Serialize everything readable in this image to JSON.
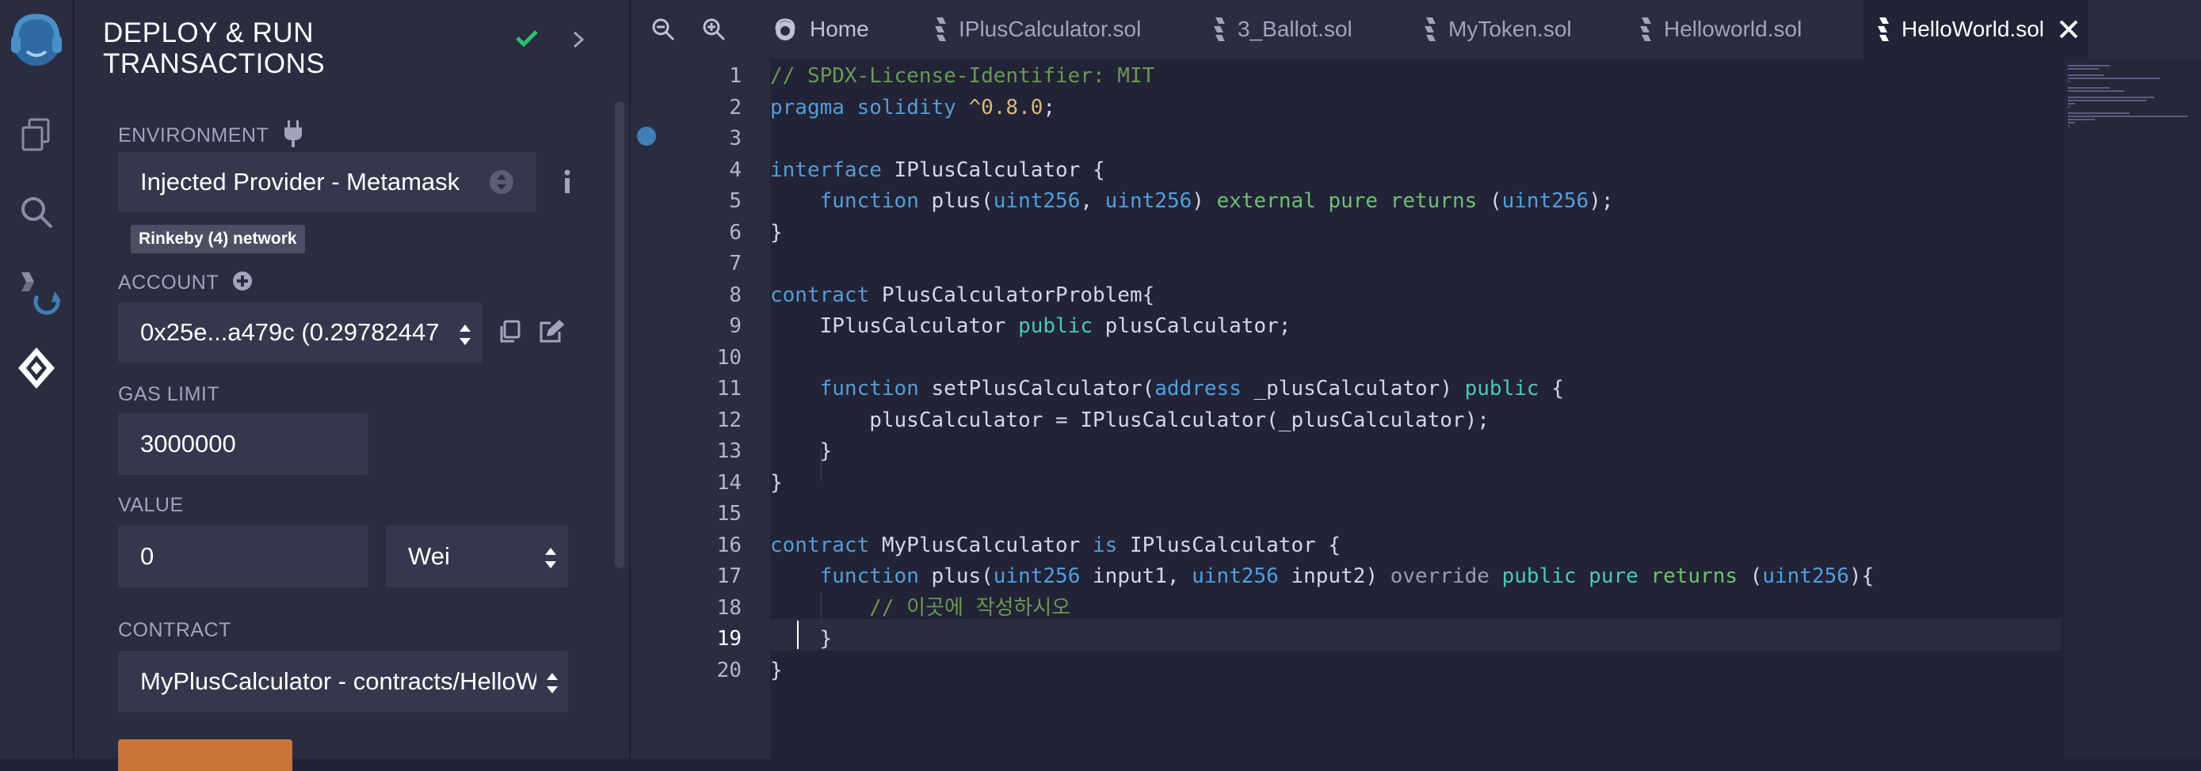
{
  "panel": {
    "title_line1": "DEPLOY & RUN",
    "title_line2": "TRANSACTIONS",
    "environment_label": "ENVIRONMENT",
    "environment_value": "Injected Provider - Metamask",
    "network_badge": "Rinkeby (4) network",
    "account_label": "ACCOUNT",
    "account_value": "0x25e...a479c (0.29782447",
    "gas_limit_label": "GAS LIMIT",
    "gas_limit_value": "3000000",
    "value_label": "VALUE",
    "value_amount": "0",
    "value_unit": "Wei",
    "contract_label": "CONTRACT",
    "contract_value": "MyPlusCalculator - contracts/HelloW"
  },
  "tabs": [
    {
      "label": "Home"
    },
    {
      "label": "IPlusCalculator.sol"
    },
    {
      "label": "3_Ballot.sol"
    },
    {
      "label": "MyToken.sol"
    },
    {
      "label": "Helloworld.sol"
    },
    {
      "label": "HelloWorld.sol"
    }
  ],
  "editor": {
    "line_numbers": [
      "1",
      "2",
      "3",
      "4",
      "5",
      "6",
      "7",
      "8",
      "9",
      "10",
      "11",
      "12",
      "13",
      "14",
      "15",
      "16",
      "17",
      "18",
      "19",
      "20"
    ],
    "lines": [
      [
        {
          "t": "// SPDX-License-Identifier: MIT",
          "c": "c-com"
        }
      ],
      [
        {
          "t": "pragma",
          "c": "c-kw"
        },
        {
          "t": " solidity ",
          "c": "c-kw"
        },
        {
          "t": "^0.8.0",
          "c": "c-num"
        },
        {
          "t": ";",
          "c": "c-pl"
        }
      ],
      [],
      [
        {
          "t": "interface",
          "c": "c-kw"
        },
        {
          "t": " IPlusCalculator {",
          "c": "c-pl"
        }
      ],
      [
        {
          "t": "    ",
          "c": "c-pl"
        },
        {
          "t": "function",
          "c": "c-kw"
        },
        {
          "t": " plus(",
          "c": "c-pl"
        },
        {
          "t": "uint256",
          "c": "c-ty"
        },
        {
          "t": ", ",
          "c": "c-pl"
        },
        {
          "t": "uint256",
          "c": "c-ty"
        },
        {
          "t": ") ",
          "c": "c-pl"
        },
        {
          "t": "external pure returns",
          "c": "c-grn"
        },
        {
          "t": " (",
          "c": "c-pl"
        },
        {
          "t": "uint256",
          "c": "c-ty"
        },
        {
          "t": ");",
          "c": "c-pl"
        }
      ],
      [
        {
          "t": "}",
          "c": "c-pl"
        }
      ],
      [],
      [
        {
          "t": "contract",
          "c": "c-kw"
        },
        {
          "t": " PlusCalculatorProblem{",
          "c": "c-pl"
        }
      ],
      [
        {
          "t": "    IPlusCalculator ",
          "c": "c-pl"
        },
        {
          "t": "public",
          "c": "c-kw2"
        },
        {
          "t": " plusCalculator;",
          "c": "c-pl"
        }
      ],
      [],
      [
        {
          "t": "    ",
          "c": "c-pl"
        },
        {
          "t": "function",
          "c": "c-kw"
        },
        {
          "t": " setPlusCalculator(",
          "c": "c-pl"
        },
        {
          "t": "address",
          "c": "c-ty"
        },
        {
          "t": " _plusCalculator) ",
          "c": "c-pl"
        },
        {
          "t": "public",
          "c": "c-kw2"
        },
        {
          "t": " {",
          "c": "c-pl"
        }
      ],
      [
        {
          "t": "        plusCalculator = IPlusCalculator(_plusCalculator);",
          "c": "c-pl"
        }
      ],
      [
        {
          "t": "    }",
          "c": "c-pl"
        }
      ],
      [
        {
          "t": "}",
          "c": "c-pl"
        }
      ],
      [],
      [
        {
          "t": "contract",
          "c": "c-kw"
        },
        {
          "t": " MyPlusCalculator ",
          "c": "c-pl"
        },
        {
          "t": "is",
          "c": "c-kw"
        },
        {
          "t": " IPlusCalculator {",
          "c": "c-pl"
        }
      ],
      [
        {
          "t": "    ",
          "c": "c-pl"
        },
        {
          "t": "function",
          "c": "c-kw"
        },
        {
          "t": " plus(",
          "c": "c-pl"
        },
        {
          "t": "uint256",
          "c": "c-ty"
        },
        {
          "t": " input1, ",
          "c": "c-pl"
        },
        {
          "t": "uint256",
          "c": "c-ty"
        },
        {
          "t": " input2) ",
          "c": "c-pl"
        },
        {
          "t": "override",
          "c": "c-dim"
        },
        {
          "t": " ",
          "c": "c-pl"
        },
        {
          "t": "public pure",
          "c": "c-kw2"
        },
        {
          "t": " ",
          "c": "c-pl"
        },
        {
          "t": "returns",
          "c": "c-grn"
        },
        {
          "t": " (",
          "c": "c-pl"
        },
        {
          "t": "uint256",
          "c": "c-ty"
        },
        {
          "t": "){",
          "c": "c-pl"
        }
      ],
      [
        {
          "t": "        // 이곳에 작성하시오",
          "c": "c-com"
        }
      ],
      [
        {
          "t": "    }",
          "c": "c-pl"
        }
      ],
      [
        {
          "t": "}",
          "c": "c-pl"
        }
      ]
    ]
  },
  "colors": {
    "accent_check": "#2fbf71",
    "breakpoint": "#3f7fb5",
    "deploy_button": "#c97539"
  }
}
